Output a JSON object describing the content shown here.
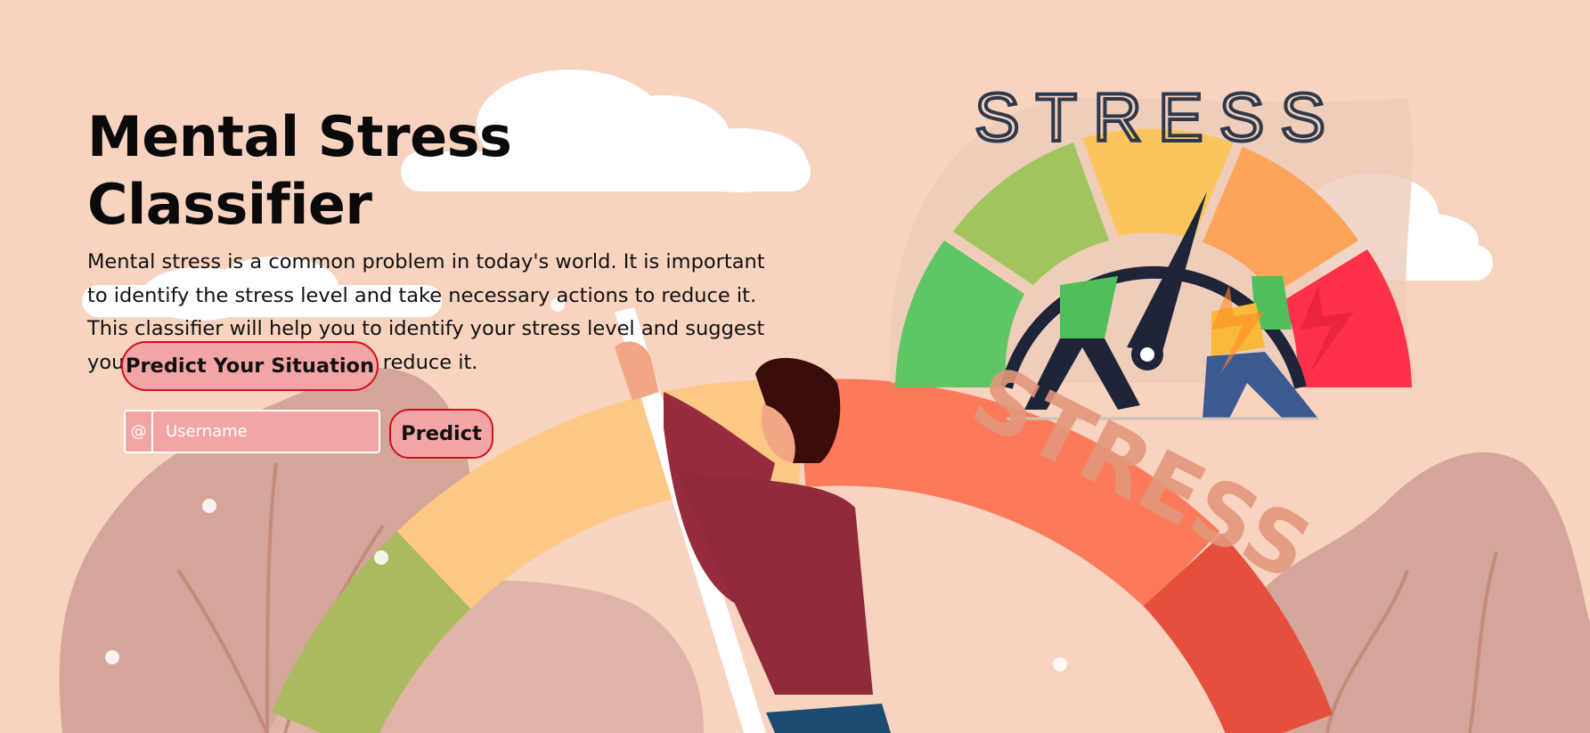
{
  "hero": {
    "title": "Mental Stress Classifier",
    "description": "Mental stress is a common problem in today's world. It is important to identify the stress level and take necessary actions to reduce it. This classifier will help you to identify your stress level and suggest you the necessary actions to reduce it."
  },
  "actions": {
    "predict_situation_label": "Predict Your Situation",
    "username_addon": "@",
    "username_placeholder": "Username",
    "username_value": "",
    "predict_label": "Predict"
  },
  "illustration": {
    "stress_heading": "STRESS",
    "stress_curved_label": "STRESS",
    "gauge_colors": [
      "#5ec663",
      "#a0c55f",
      "#fbc55e",
      "#fca45a",
      "#ff3149"
    ],
    "meter_colors": [
      "#abb960",
      "#fcc885",
      "#fc7a5a",
      "#e5503e"
    ],
    "background_color": "#f8d3c0"
  }
}
